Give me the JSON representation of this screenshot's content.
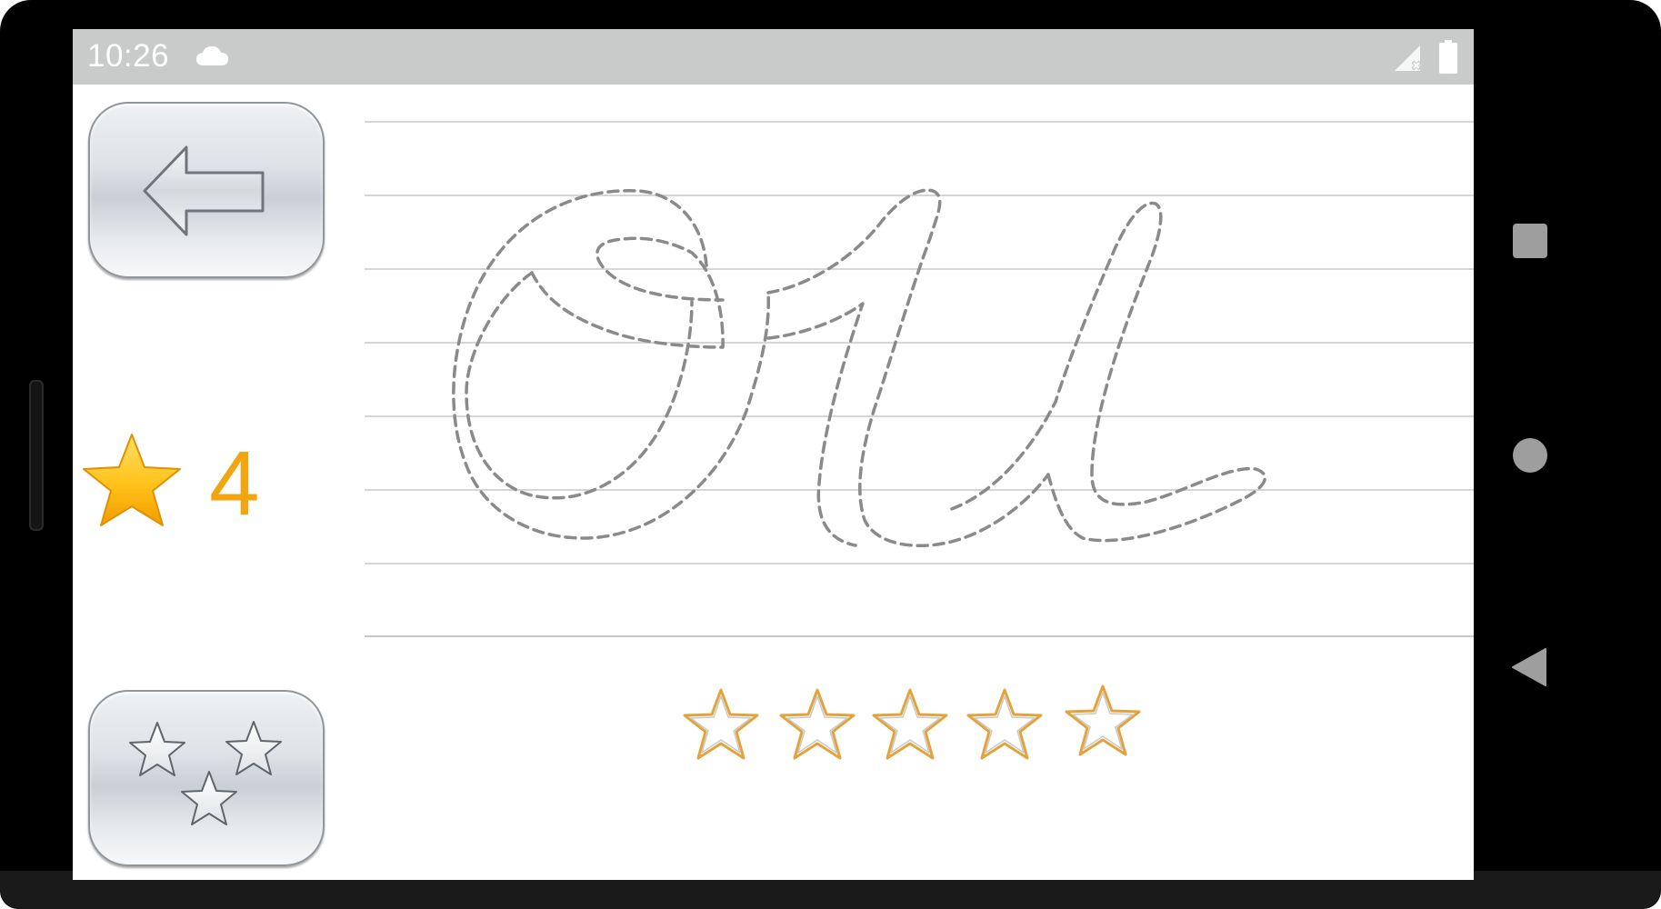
{
  "status_bar": {
    "time": "10:26",
    "icons": [
      "cloud-icon",
      "signal-off-icon",
      "battery-icon"
    ]
  },
  "sidebar": {
    "back_button_icon": "arrow-left-icon",
    "score_icon": "star-icon",
    "score_value": "4",
    "achievements_button_icon": "three-stars-icon"
  },
  "exercise": {
    "traced_letters": "Ou",
    "rating": {
      "earned": 0,
      "total": 5
    }
  },
  "navigation_bar": {
    "buttons": [
      "recents-square",
      "home-circle",
      "back-triangle"
    ]
  },
  "colors": {
    "accent_orange": "#f3a50f",
    "star_outline": "#e3a33a",
    "dash_gray": "#8a8a8a",
    "status_bar": "#c9cbcb"
  }
}
